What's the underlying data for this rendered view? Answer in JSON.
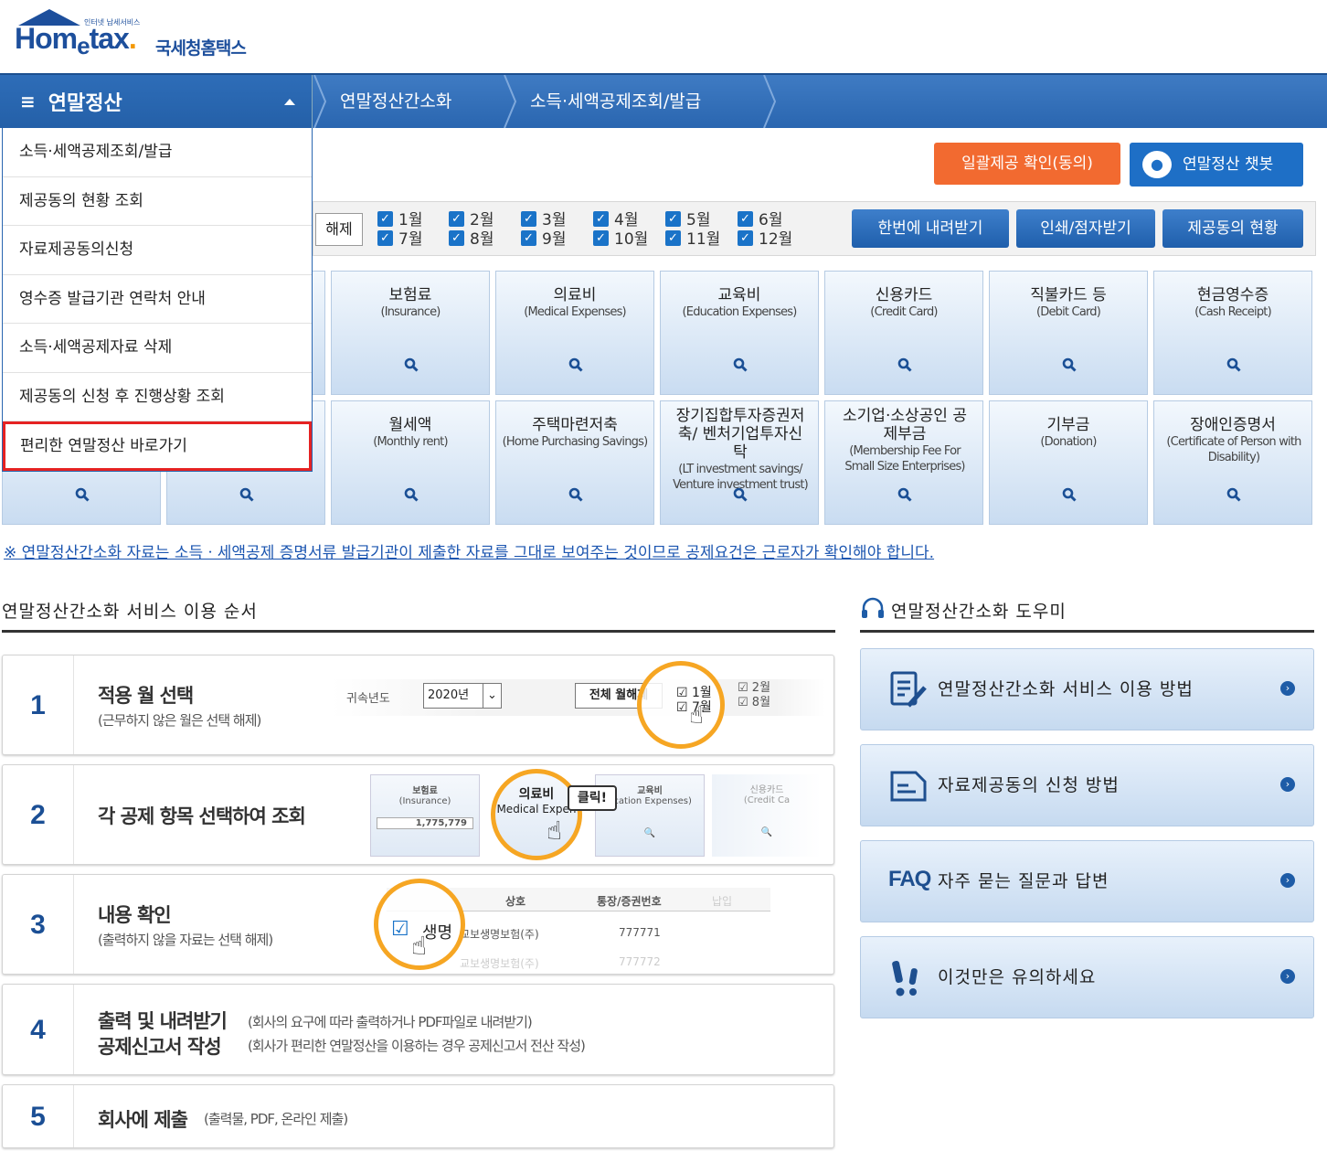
{
  "logo": {
    "small": "인터넷 납세서비스",
    "en1": "Hom",
    "en2": "e",
    "en3": "tax",
    "ko": "국세청홈택스"
  },
  "nav": {
    "menu_title": "연말정산",
    "crumbs": [
      "연말정산간소화",
      "소득·세액공제조회/발급"
    ]
  },
  "dropdown": [
    "소득·세액공제조회/발급",
    "제공동의 현황 조회",
    "자료제공동의신청",
    "영수증 발급기관 연락처 안내",
    "소득·세액공제자료 삭제",
    "제공동의 신청 후 진행상황 조회",
    "편리한 연말정산 바로가기"
  ],
  "buttons": {
    "consent": "일괄제공 확인(동의)",
    "chatbot": "연말정산 챗봇",
    "release": "해제",
    "download_all": "한번에 내려받기",
    "print": "인쇄/점자받기",
    "consent_status": "제공동의 현황"
  },
  "months": [
    "1월",
    "2월",
    "3월",
    "4월",
    "5월",
    "6월",
    "7월",
    "8월",
    "9월",
    "10월",
    "11월",
    "12월"
  ],
  "categories": [
    {
      "ko": "보험료",
      "en": "(Insurance)"
    },
    {
      "ko": "의료비",
      "en": "(Medical Expenses)"
    },
    {
      "ko": "교육비",
      "en": "(Education Expenses)"
    },
    {
      "ko": "신용카드",
      "en": "(Credit Card)"
    },
    {
      "ko": "직불카드 등",
      "en": "(Debit Card)"
    },
    {
      "ko": "현금영수증",
      "en": "(Cash Receipt)"
    },
    {
      "ko": "월세액",
      "en": "(Monthly rent)"
    },
    {
      "ko": "주택마련저축",
      "en": "(Home Purchasing Savings)"
    },
    {
      "ko": "장기집합투자증권저축/ 벤처기업투자신탁",
      "en": "(LT investment savings/ Venture investment trust)"
    },
    {
      "ko": "소기업·소상공인 공제부금",
      "en": "(Membership Fee For Small Size Enterprises)"
    },
    {
      "ko": "기부금",
      "en": "(Donation)"
    },
    {
      "ko": "장애인증명서",
      "en": "(Certificate of Person with Disability)"
    }
  ],
  "notice": "※ 연말정산간소화 자료는 소득ㆍ세액공제 증명서류 발급기관이 제출한 자료를 그대로 보여주는 것이므로 공제요건은 근로자가 확인해야 합니다.",
  "steps_title": "연말정산간소화 서비스 이용 순서",
  "steps": [
    {
      "num": "1",
      "t1": "적용 월 선택",
      "t2": "(근무하지 않은 월은 선택 해제)"
    },
    {
      "num": "2",
      "t1": "각 공제 항목 선택하여 조회",
      "t2": ""
    },
    {
      "num": "3",
      "t1": "내용 확인",
      "t2": "(출력하지 않을 자료는 선택 해제)"
    },
    {
      "num": "4",
      "t1": "출력 및 내려받기",
      "t1b": "공제신고서 작성",
      "t2": "(회사의 요구에 따라 출력하거나 PDF파일로 내려받기)",
      "t2b": "(회사가 편리한 연말정산을 이용하는 경우 공제신고서 전산 작성)"
    },
    {
      "num": "5",
      "t1": "회사에 제출",
      "t2": "(출력물, PDF, 온라인 제출)"
    }
  ],
  "step_illus": {
    "s1": {
      "year_label": "귀속년도",
      "year": "2020년",
      "all_release": "전체 월해제",
      "m": [
        "1월",
        "7월",
        "2월",
        "8월"
      ]
    },
    "s2": {
      "c1": "보험료",
      "c1e": "(Insurance)",
      "c1v": "1,775,779",
      "c2": "의료비",
      "c2e": "Medical Expen",
      "click": "클릭!",
      "c3": "교육비",
      "c3e": "ucation Expenses)",
      "c4": "신용카드",
      "c4e": "(Credit Ca"
    },
    "s3": {
      "h1": "상호",
      "h2": "통장/증권번호",
      "h3": "납입",
      "r1": "생명",
      "r1b": "교보생명보험(주)",
      "r1c": "777771",
      "r2b": "교보생명보험(주)",
      "r2c": "777772"
    }
  },
  "help_title": "연말정산간소화 도우미",
  "help": [
    "연말정산간소화 서비스 이용 방법",
    "자료제공동의 신청 방법",
    "자주 묻는 질문과 답변",
    "이것만은 유의하세요"
  ],
  "help_faq": "FAQ"
}
